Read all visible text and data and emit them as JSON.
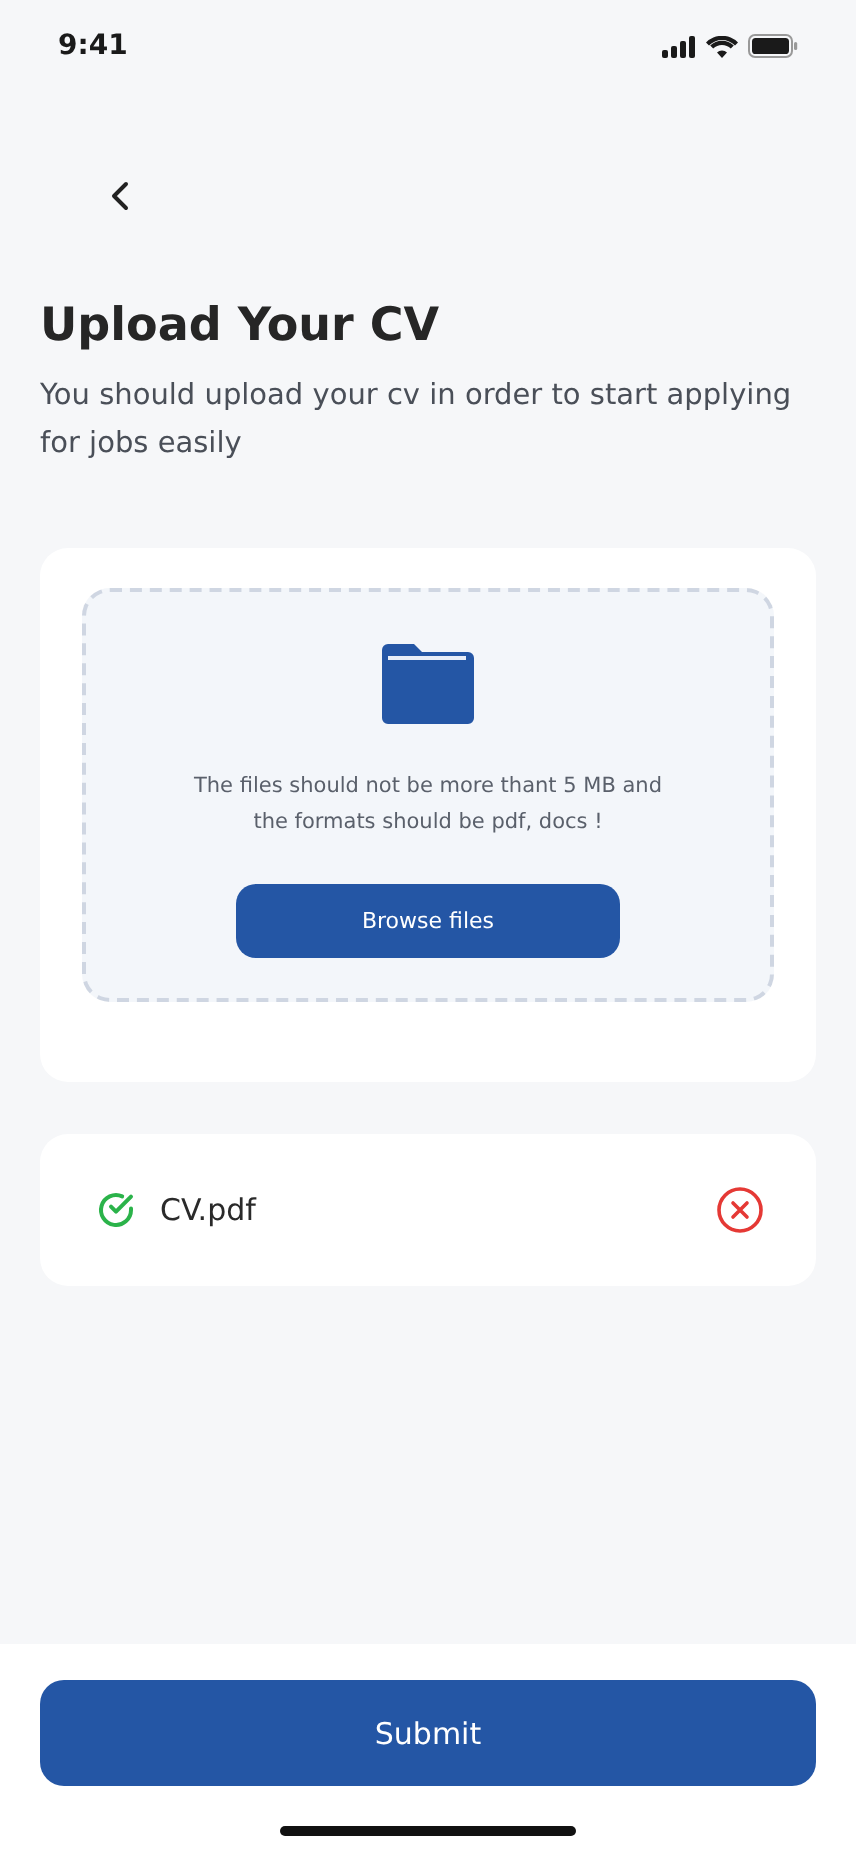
{
  "status_bar": {
    "time": "9:41"
  },
  "header": {
    "title": "Upload Your CV",
    "subtitle": "You should upload your cv in order to start applying for jobs easily"
  },
  "dropzone": {
    "hint": "The files should not be more thant 5 MB and the formats should be pdf, docs !",
    "button": "Browse files"
  },
  "files": [
    {
      "name": "CV.pdf",
      "uploaded": true
    }
  ],
  "submit": "Submit"
}
